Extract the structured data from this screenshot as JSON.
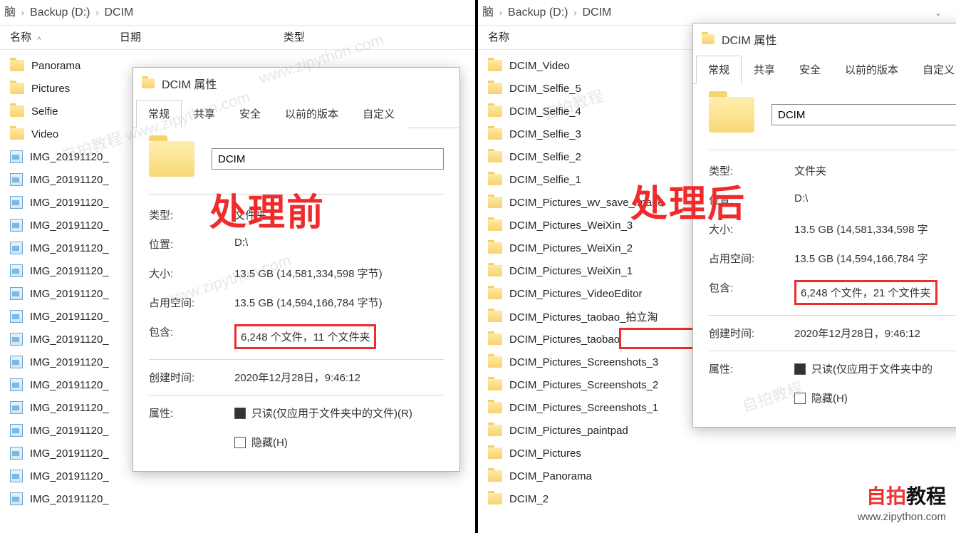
{
  "breadcrumb": {
    "pc": "脑",
    "drive": "Backup (D:)",
    "folder": "DCIM"
  },
  "columns": {
    "name": "名称",
    "date": "日期",
    "type": "类型"
  },
  "left": {
    "stamp": "处理前",
    "files": [
      {
        "kind": "folder",
        "label": "Panorama"
      },
      {
        "kind": "folder",
        "label": "Pictures"
      },
      {
        "kind": "folder",
        "label": "Selfie"
      },
      {
        "kind": "folder",
        "label": "Video"
      },
      {
        "kind": "image",
        "label": "IMG_20191120_"
      },
      {
        "kind": "image",
        "label": "IMG_20191120_"
      },
      {
        "kind": "image",
        "label": "IMG_20191120_"
      },
      {
        "kind": "image",
        "label": "IMG_20191120_"
      },
      {
        "kind": "image",
        "label": "IMG_20191120_"
      },
      {
        "kind": "image",
        "label": "IMG_20191120_"
      },
      {
        "kind": "image",
        "label": "IMG_20191120_"
      },
      {
        "kind": "image",
        "label": "IMG_20191120_"
      },
      {
        "kind": "image",
        "label": "IMG_20191120_"
      },
      {
        "kind": "image",
        "label": "IMG_20191120_"
      },
      {
        "kind": "image",
        "label": "IMG_20191120_"
      },
      {
        "kind": "image",
        "label": "IMG_20191120_"
      },
      {
        "kind": "image",
        "label": "IMG_20191120_"
      },
      {
        "kind": "image",
        "label": "IMG_20191120_"
      },
      {
        "kind": "image",
        "label": "IMG_20191120_"
      },
      {
        "kind": "image",
        "label": "IMG_20191120_"
      }
    ],
    "dlg": {
      "title": "DCIM 属性",
      "tabs": {
        "general": "常规",
        "share": "共享",
        "security": "安全",
        "prev": "以前的版本",
        "custom": "自定义"
      },
      "name": "DCIM",
      "type_k": "类型:",
      "type_v": "文件夹",
      "loc_k": "位置:",
      "loc_v": "D:\\",
      "size_k": "大小:",
      "size_v": "13.5 GB (14,581,334,598 字节)",
      "disk_k": "占用空间:",
      "disk_v": "13.5 GB (14,594,166,784 字节)",
      "cont_k": "包含:",
      "cont_v": "6,248 个文件，11 个文件夹",
      "ctime_k": "创建时间:",
      "ctime_v": "2020年12月28日，9:46:12",
      "attr_k": "属性:",
      "readonly": "只读(仅应用于文件夹中的文件)(R)",
      "hidden": "隐藏(H)"
    }
  },
  "right": {
    "stamp": "处理后",
    "files": [
      {
        "kind": "folder",
        "label": "DCIM_Video"
      },
      {
        "kind": "folder",
        "label": "DCIM_Selfie_5"
      },
      {
        "kind": "folder",
        "label": "DCIM_Selfie_4"
      },
      {
        "kind": "folder",
        "label": "DCIM_Selfie_3"
      },
      {
        "kind": "folder",
        "label": "DCIM_Selfie_2"
      },
      {
        "kind": "folder",
        "label": "DCIM_Selfie_1"
      },
      {
        "kind": "folder",
        "label": "DCIM_Pictures_wv_save_image"
      },
      {
        "kind": "folder",
        "label": "DCIM_Pictures_WeiXin_3"
      },
      {
        "kind": "folder",
        "label": "DCIM_Pictures_WeiXin_2"
      },
      {
        "kind": "folder",
        "label": "DCIM_Pictures_WeiXin_1"
      },
      {
        "kind": "folder",
        "label": "DCIM_Pictures_VideoEditor"
      },
      {
        "kind": "folder",
        "label": "DCIM_Pictures_taobao_拍立淘"
      },
      {
        "kind": "folder",
        "label": "DCIM_Pictures_taobao"
      },
      {
        "kind": "folder",
        "label": "DCIM_Pictures_Screenshots_3"
      },
      {
        "kind": "folder",
        "label": "DCIM_Pictures_Screenshots_2"
      },
      {
        "kind": "folder",
        "label": "DCIM_Pictures_Screenshots_1"
      },
      {
        "kind": "folder",
        "label": "DCIM_Pictures_paintpad"
      },
      {
        "kind": "folder",
        "label": "DCIM_Pictures"
      },
      {
        "kind": "folder",
        "label": "DCIM_Panorama"
      },
      {
        "kind": "folder",
        "label": "DCIM_2"
      }
    ],
    "dlg": {
      "title": "DCIM 属性",
      "tabs": {
        "general": "常规",
        "share": "共享",
        "security": "安全",
        "prev": "以前的版本",
        "custom": "自定义"
      },
      "name": "DCIM",
      "type_k": "类型:",
      "type_v": "文件夹",
      "loc_k": "位置:",
      "loc_v": "D:\\",
      "size_k": "大小:",
      "size_v": "13.5 GB (14,581,334,598 字",
      "disk_k": "占用空间:",
      "disk_v": "13.5 GB (14,594,166,784 字",
      "cont_k": "包含:",
      "cont_v": "6,248 个文件，21 个文件夹",
      "ctime_k": "创建时间:",
      "ctime_v": "2020年12月28日，9:46:12",
      "attr_k": "属性:",
      "readonly": "只读(仅应用于文件夹中的",
      "hidden": "隐藏(H)"
    }
  },
  "watermark": {
    "brand_a": "自拍",
    "brand_b": "教程",
    "url": "www.zipython.com"
  }
}
